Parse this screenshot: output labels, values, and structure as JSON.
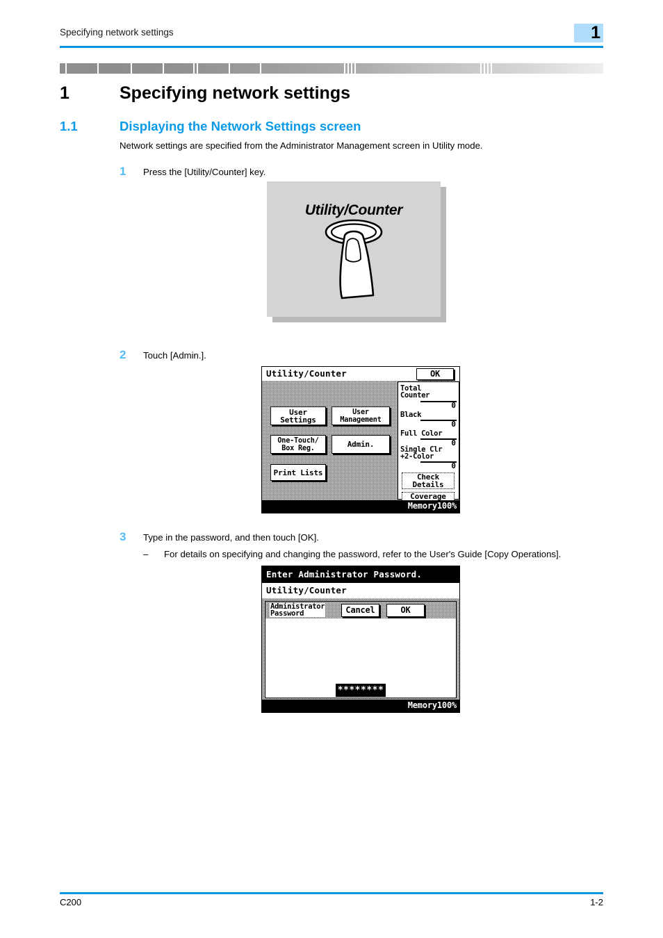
{
  "header": {
    "running_title": "Specifying network settings",
    "chapter_marker": "1"
  },
  "chapter": {
    "number": "1",
    "title": "Specifying network settings"
  },
  "section": {
    "number": "1.1",
    "title": "Displaying the Network Settings screen",
    "intro": "Network settings are specified from the Administrator Management screen in Utility mode."
  },
  "steps": [
    {
      "number": "1",
      "text": "Press the [Utility/Counter] key."
    },
    {
      "number": "2",
      "text": "Touch [Admin.]."
    },
    {
      "number": "3",
      "text": "Type in the password, and then touch [OK].",
      "sub": "For details on specifying and changing the password, refer to the User's Guide [Copy Operations].",
      "sub_dash": "–"
    }
  ],
  "figure_key": {
    "label": "Utility/Counter"
  },
  "lcd_utility": {
    "title": "Utility/Counter",
    "ok_label": "OK",
    "buttons": [
      {
        "label": "User\nSettings"
      },
      {
        "label": "User\nManagement"
      },
      {
        "label": "One-Touch/\nBox Reg."
      },
      {
        "label": "Admin."
      },
      {
        "label": "Print Lists"
      }
    ],
    "counter": {
      "rows": [
        {
          "label": "Total\nCounter",
          "value": "0"
        },
        {
          "label": "Black",
          "value": "0"
        },
        {
          "label": "Full Color",
          "value": "0"
        },
        {
          "label": "Single Clr\n+2-Color",
          "value": "0"
        }
      ],
      "check_details": "Check\nDetails",
      "coverage_rate": "Coverage\nRate"
    },
    "memory": "Memory100%"
  },
  "lcd_password": {
    "banner": "Enter Administrator Password.",
    "subtitle": "Utility/Counter",
    "dialog_label": "Administrator\nPassword",
    "cancel_label": "Cancel",
    "ok_label": "OK",
    "password_value": "********",
    "memory": "Memory100%"
  },
  "footer": {
    "left": "C200",
    "right": "1-2"
  },
  "colors": {
    "accent_blue": "#0b9ae8",
    "rule_blue": "#0a94dd",
    "step_blue": "#55bdf4",
    "chapter_box": "#afddfb"
  }
}
